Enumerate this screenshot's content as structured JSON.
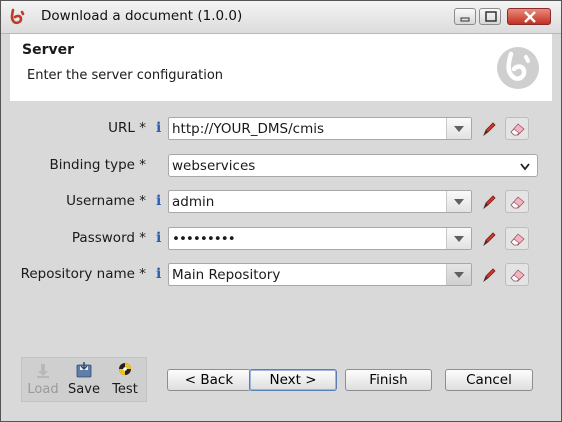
{
  "window": {
    "title": "Download a document (1.0.0)"
  },
  "header": {
    "title": "Server",
    "subtitle": "Enter the server configuration"
  },
  "form": {
    "info_glyph": "i",
    "url": {
      "label": "URL *",
      "value": "http://YOUR_DMS/cmis"
    },
    "binding": {
      "label": "Binding type *",
      "value": "webservices"
    },
    "username": {
      "label": "Username *",
      "value": "admin"
    },
    "password": {
      "label": "Password *",
      "value": "•••••••••"
    },
    "repository": {
      "label": "Repository name *",
      "value": "Main Repository"
    }
  },
  "toolbar": {
    "load_label": "Load",
    "save_label": "Save",
    "test_label": "Test"
  },
  "buttons": {
    "back": "< Back",
    "next": "Next >",
    "finish": "Finish",
    "cancel": "Cancel"
  },
  "colors": {
    "accent": "#c0392b",
    "info": "#2a5db0"
  },
  "icons": [
    "app-logo-icon",
    "minimize-icon",
    "maximize-icon",
    "close-icon",
    "pencil-icon",
    "eraser-icon",
    "load-icon",
    "save-icon",
    "test-icon"
  ]
}
